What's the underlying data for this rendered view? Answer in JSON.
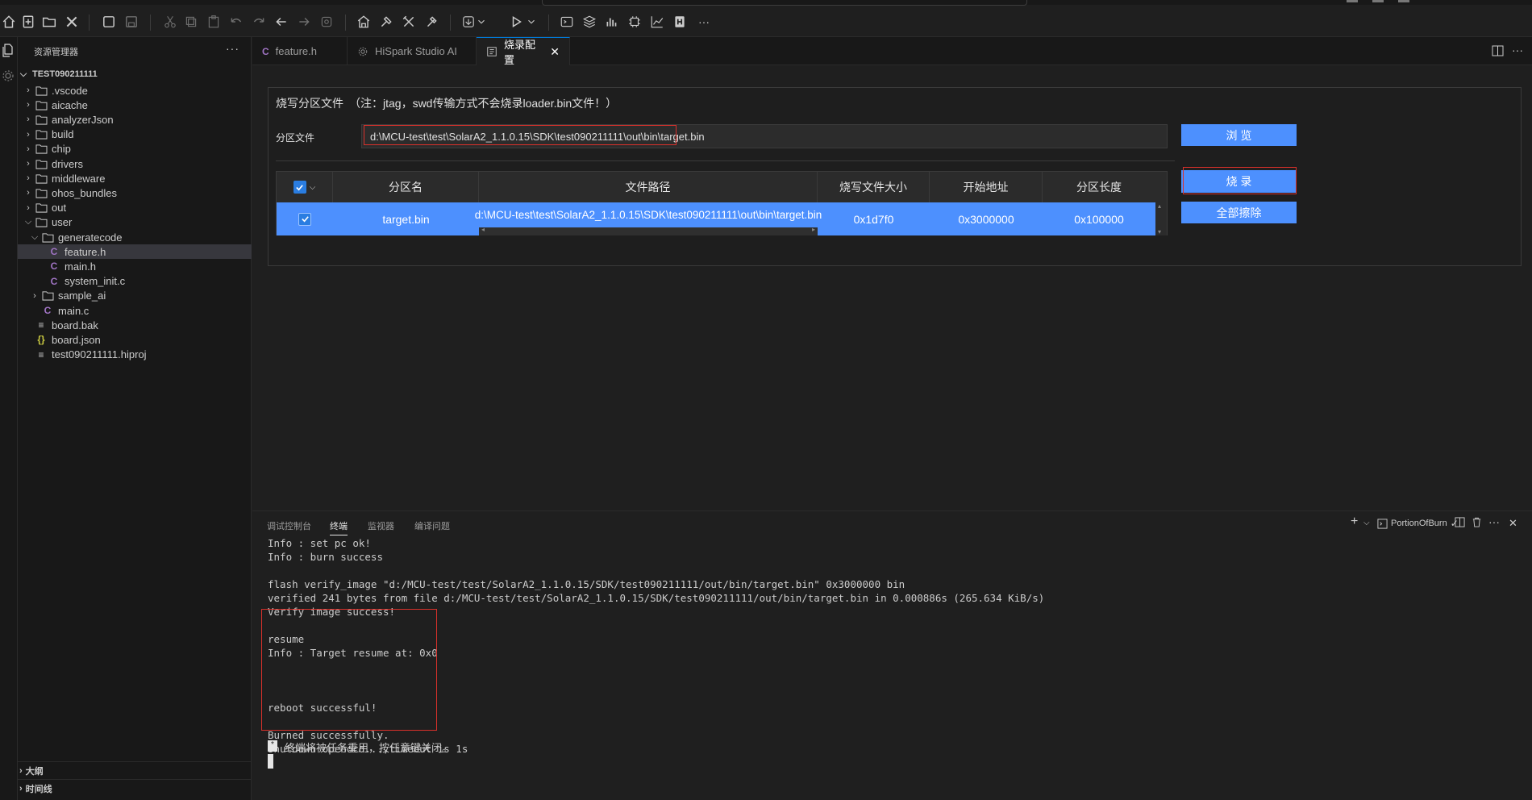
{
  "toolbar": {
    "more_label": "···"
  },
  "sidebar": {
    "title": "资源管理器",
    "more": "···",
    "project": "TEST090211111",
    "items": [
      {
        "label": ".vscode",
        "type": "folder",
        "expanded": false,
        "level": 1
      },
      {
        "label": "aicache",
        "type": "folder",
        "expanded": false,
        "level": 1
      },
      {
        "label": "analyzerJson",
        "type": "folder",
        "expanded": false,
        "level": 1
      },
      {
        "label": "build",
        "type": "folder",
        "expanded": false,
        "level": 1
      },
      {
        "label": "chip",
        "type": "folder",
        "expanded": false,
        "level": 1
      },
      {
        "label": "drivers",
        "type": "folder",
        "expanded": false,
        "level": 1
      },
      {
        "label": "middleware",
        "type": "folder",
        "expanded": false,
        "level": 1
      },
      {
        "label": "ohos_bundles",
        "type": "folder",
        "expanded": false,
        "level": 1
      },
      {
        "label": "out",
        "type": "folder",
        "expanded": false,
        "level": 1
      },
      {
        "label": "user",
        "type": "folder",
        "expanded": true,
        "level": 1
      },
      {
        "label": "generatecode",
        "type": "folder",
        "expanded": true,
        "level": 2
      },
      {
        "label": "feature.h",
        "type": "c",
        "level": 3,
        "selected": true
      },
      {
        "label": "main.h",
        "type": "c",
        "level": 3
      },
      {
        "label": "system_init.c",
        "type": "c",
        "level": 3
      },
      {
        "label": "sample_ai",
        "type": "folder",
        "expanded": false,
        "level": 2
      },
      {
        "label": "main.c",
        "type": "c",
        "level": 2
      },
      {
        "label": "board.bak",
        "type": "lines",
        "level": 1
      },
      {
        "label": "board.json",
        "type": "json",
        "level": 1
      },
      {
        "label": "test090211111.hiproj",
        "type": "lines",
        "level": 1
      }
    ],
    "outline": "大纲",
    "timeline": "时间线"
  },
  "tabs": [
    {
      "label": "feature.h",
      "icon": "c-file-icon",
      "active": false
    },
    {
      "label": "HiSpark Studio AI",
      "icon": "gear-icon",
      "active": false
    },
    {
      "label": "烧录配置",
      "icon": "settings-file-icon",
      "active": true
    }
  ],
  "burn": {
    "section_title": "烧写分区文件",
    "note": "（注：jtag，swd传输方式不会烧录loader.bin文件！）",
    "partition_file_label": "分区文件",
    "partition_file_value": "d:\\MCU-test\\test\\SolarA2_1.1.0.15\\SDK\\test090211111\\out\\bin\\target.bin",
    "browse_button": "浏 览",
    "burn_button": "烧 录",
    "erase_button": "全部擦除",
    "table": {
      "headers": [
        "分区名",
        "文件路径",
        "烧写文件大小",
        "开始地址",
        "分区长度"
      ],
      "rows": [
        {
          "checked": true,
          "name": "target.bin",
          "path": "d:\\MCU-test\\test\\SolarA2_1.1.0.15\\SDK\\test090211111\\out\\bin\\target.bin",
          "size": "0x1d7f0",
          "start": "0x3000000",
          "length": "0x100000"
        }
      ]
    }
  },
  "panel": {
    "tabs": [
      "调试控制台",
      "终端",
      "监视器",
      "编译问题"
    ],
    "active_tab": "终端",
    "terminal_name": "PortionOfBurn",
    "lines": [
      "Info : set pc ok!",
      "Info : burn success",
      "",
      "flash verify_image \"d:/MCU-test/test/SolarA2_1.1.0.15/SDK/test090211111/out/bin/target.bin\" 0x3000000 bin",
      "verified 241 bytes from file d:/MCU-test/test/SolarA2_1.1.0.15/SDK/test090211111/out/bin/target.bin in 0.000886s (265.634 KiB/s)",
      "Verify image success!",
      "",
      "resume",
      "Info : Target resume at: 0x0",
      "",
      "",
      "",
      "reboot successful!",
      "",
      "Burned successfully.",
      "shutdown openocd...,timeout is 1s"
    ],
    "final_message": "终端将被任务重用，按任意键关闭。"
  }
}
